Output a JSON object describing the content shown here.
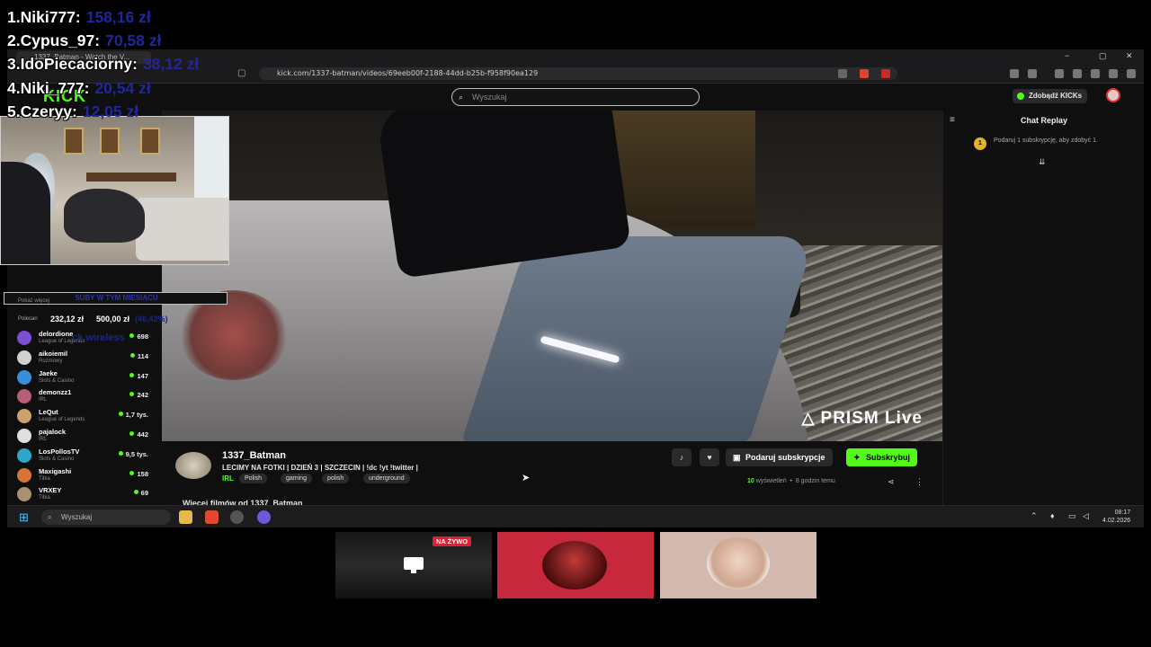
{
  "leaderboard": [
    {
      "rank_name": "1.Niki777:",
      "amount": "158,16 zł"
    },
    {
      "rank_name": "2.Cypus_97:",
      "amount": "70,58 zł"
    },
    {
      "rank_name": "3.IdoPiecaciorny:",
      "amount": "38,12 zł"
    },
    {
      "rank_name": "4.Niki_777:",
      "amount": "20,54 zł"
    },
    {
      "rank_name": "5.Czeryy:",
      "amount": "12,05 zł"
    }
  ],
  "browser": {
    "tab_title": "1337_Batman - Watch the V...",
    "url": "kick.com/1337-batman/videos/69eeb00f-2188-44dd-b25b-f958f90ea129",
    "window_controls": [
      "−",
      "▢",
      "✕"
    ]
  },
  "kick": {
    "logo": "KICK",
    "search_placeholder": "Wyszukaj",
    "get_kicks_label": "Zdobądź KICKs"
  },
  "video": {
    "watermark": "PRISM Live"
  },
  "chat": {
    "title": "Chat Replay",
    "gift_badge": "1",
    "gift_text": "Podaruj 1 subskrypcję, aby zdobyć 1."
  },
  "stream": {
    "channel": "1337_Batman",
    "title": "LECIMY NA FOTKI | DZIEŃ 3 | SZCZECIN | !dc !yt !twitter |",
    "category": "IRL",
    "tags": [
      "Polish",
      "gaming",
      "polish",
      "underground"
    ],
    "gift_button": "Podaruj subskrypcje",
    "subscribe_button": "Subskrybuj",
    "views_num": "10",
    "views_text": "wyświetleń",
    "time_ago": "8 godzin temu",
    "more_videos": "Więcej filmów od 1337_Batman"
  },
  "goal": {
    "bar_text": "SUBY W TYM MIESIĄCU",
    "sub_text": "Pokaż więcej",
    "current": "232,12 zł",
    "target": "500,00 zł",
    "percent": "(46,42%)",
    "section_label": "Polecan",
    "overlay_text": "ck wireless"
  },
  "recommended": [
    {
      "name": "delordione",
      "category": "League of Legends",
      "viewers": "698",
      "color": "#7a4fd1"
    },
    {
      "name": "aikoiemil",
      "category": "Rozmowy",
      "viewers": "114",
      "color": "#d0d0d0"
    },
    {
      "name": "Jaeke",
      "category": "Slots & Casino",
      "viewers": "147",
      "color": "#3a8ed8"
    },
    {
      "name": "demonzz1",
      "category": "IRL",
      "viewers": "242",
      "color": "#b85c78"
    },
    {
      "name": "LeQut",
      "category": "League of Legends",
      "viewers": "1,7 tys.",
      "color": "#c9a36a"
    },
    {
      "name": "pajalock",
      "category": "IRL",
      "viewers": "442",
      "color": "#e0e0e0"
    },
    {
      "name": "LosPollosTV",
      "category": "Slots & Casino",
      "viewers": "9,5 tys.",
      "color": "#2fa6c8"
    },
    {
      "name": "Maxigashi",
      "category": "Tibia",
      "viewers": "158",
      "color": "#d8743a"
    },
    {
      "name": "VRXEY",
      "category": "Tibia",
      "viewers": "69",
      "color": "#a89070"
    }
  ],
  "taskbar": {
    "search_placeholder": "Wyszukaj",
    "time": "08:17",
    "date": "4.02.2026"
  },
  "call": {
    "live_badge": "NA ŻYWO"
  }
}
